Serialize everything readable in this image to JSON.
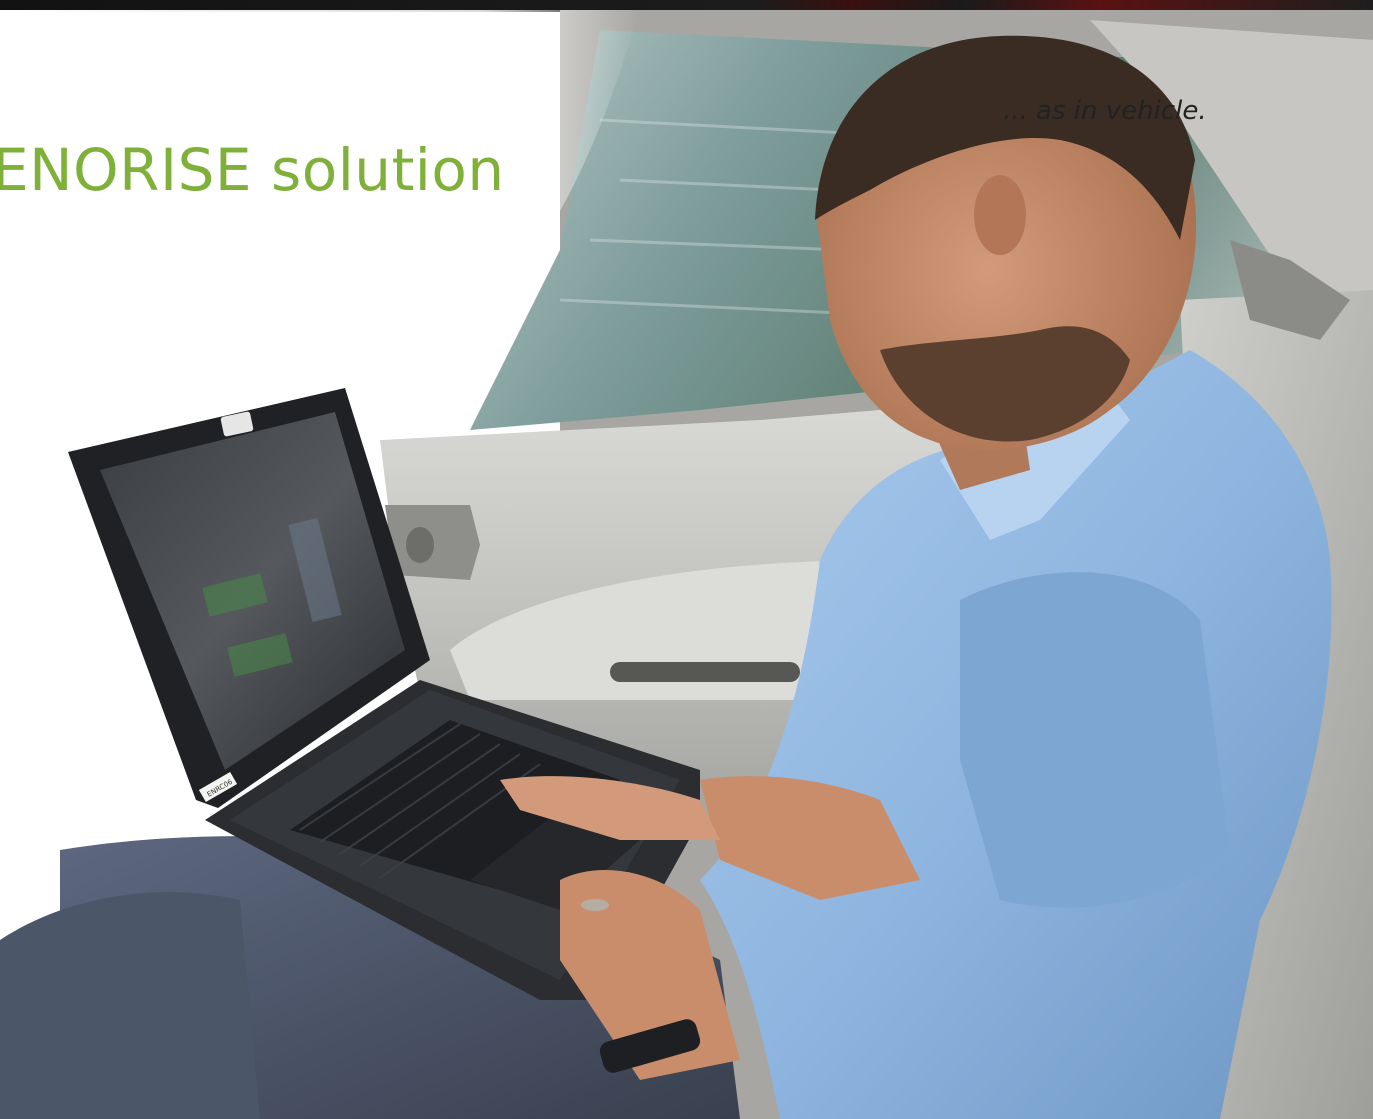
{
  "headline": {
    "text": "ENORISE solution",
    "color": "#7fb03a"
  },
  "caption": {
    "text": "... as in vehicle."
  },
  "photo": {
    "subject": "man in light blue polo shirt typing on laptop in car rear seat",
    "laptop_label": "ENRC06",
    "colors": {
      "shirt": "#8fb6e0",
      "seat": "#b9b9b4",
      "door_panel": "#c9c9c6",
      "laptop": "#2b2d31",
      "trousers": "#4c5669",
      "skin": "#c98d6b",
      "window_blur": "#8aa9a8"
    }
  }
}
